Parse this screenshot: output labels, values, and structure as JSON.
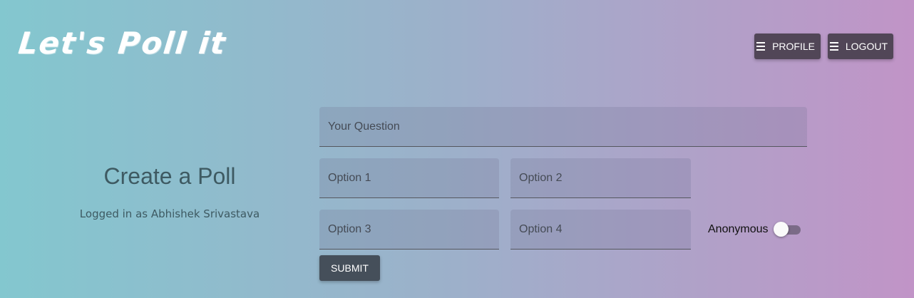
{
  "app": {
    "title": "Let's Poll it"
  },
  "nav": {
    "profile_label": "PROFILE",
    "logout_label": "LOGOUT"
  },
  "page": {
    "heading": "Create a Poll",
    "logged_in_text": "Logged in as Abhishek Srivastava"
  },
  "form": {
    "question_placeholder": "Your Question",
    "option1_placeholder": "Option 1",
    "option2_placeholder": "Option 2",
    "option3_placeholder": "Option 3",
    "option4_placeholder": "Option 4",
    "anonymous_label": "Anonymous",
    "anonymous_on": false,
    "submit_label": "SUBMIT"
  },
  "colors": {
    "nav_button": "#514657",
    "submit_button": "#454f5a",
    "text_dark": "#3e5a62",
    "gradient_start": "#83c7cf",
    "gradient_end": "#c194c7"
  },
  "icons": {
    "nav_icon": "menu-icon"
  }
}
